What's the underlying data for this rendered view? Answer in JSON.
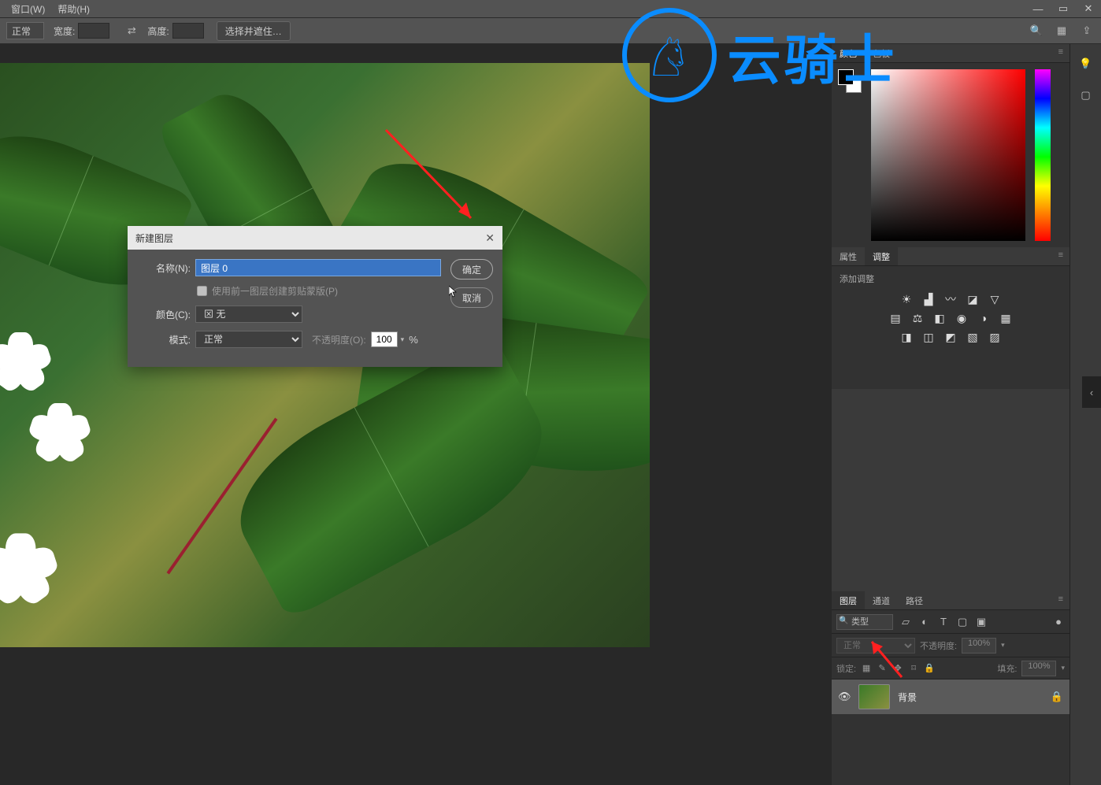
{
  "menu": {
    "window": "窗口(W)",
    "help": "帮助(H)"
  },
  "options": {
    "mode": "正常",
    "width_label": "宽度:",
    "height_label": "高度:",
    "select_and": "选择并遮住…"
  },
  "dialog": {
    "title": "新建图层",
    "name_label": "名称(N):",
    "name_value": "图层 0",
    "clip_label": "使用前一图层创建剪贴蒙版(P)",
    "color_label": "颜色(C):",
    "color_value": "无",
    "mode_label": "模式:",
    "mode_value": "正常",
    "opacity_label": "不透明度(O):",
    "opacity_value": "100",
    "pct": "%",
    "ok": "确定",
    "cancel": "取消"
  },
  "panels": {
    "color_tabs": [
      "颜色",
      "色板"
    ],
    "props_tabs": [
      "属性",
      "调整"
    ],
    "adj_title": "添加调整",
    "layer_tabs": [
      "图层",
      "通道",
      "路径"
    ]
  },
  "layers": {
    "filter": "类型",
    "blend": "正常",
    "opacity_label": "不透明度:",
    "opacity": "100%",
    "lock_label": "锁定:",
    "fill_label": "填充:",
    "fill": "100%",
    "items": [
      {
        "name": "背景"
      }
    ]
  },
  "watermark_text": "云骑士"
}
